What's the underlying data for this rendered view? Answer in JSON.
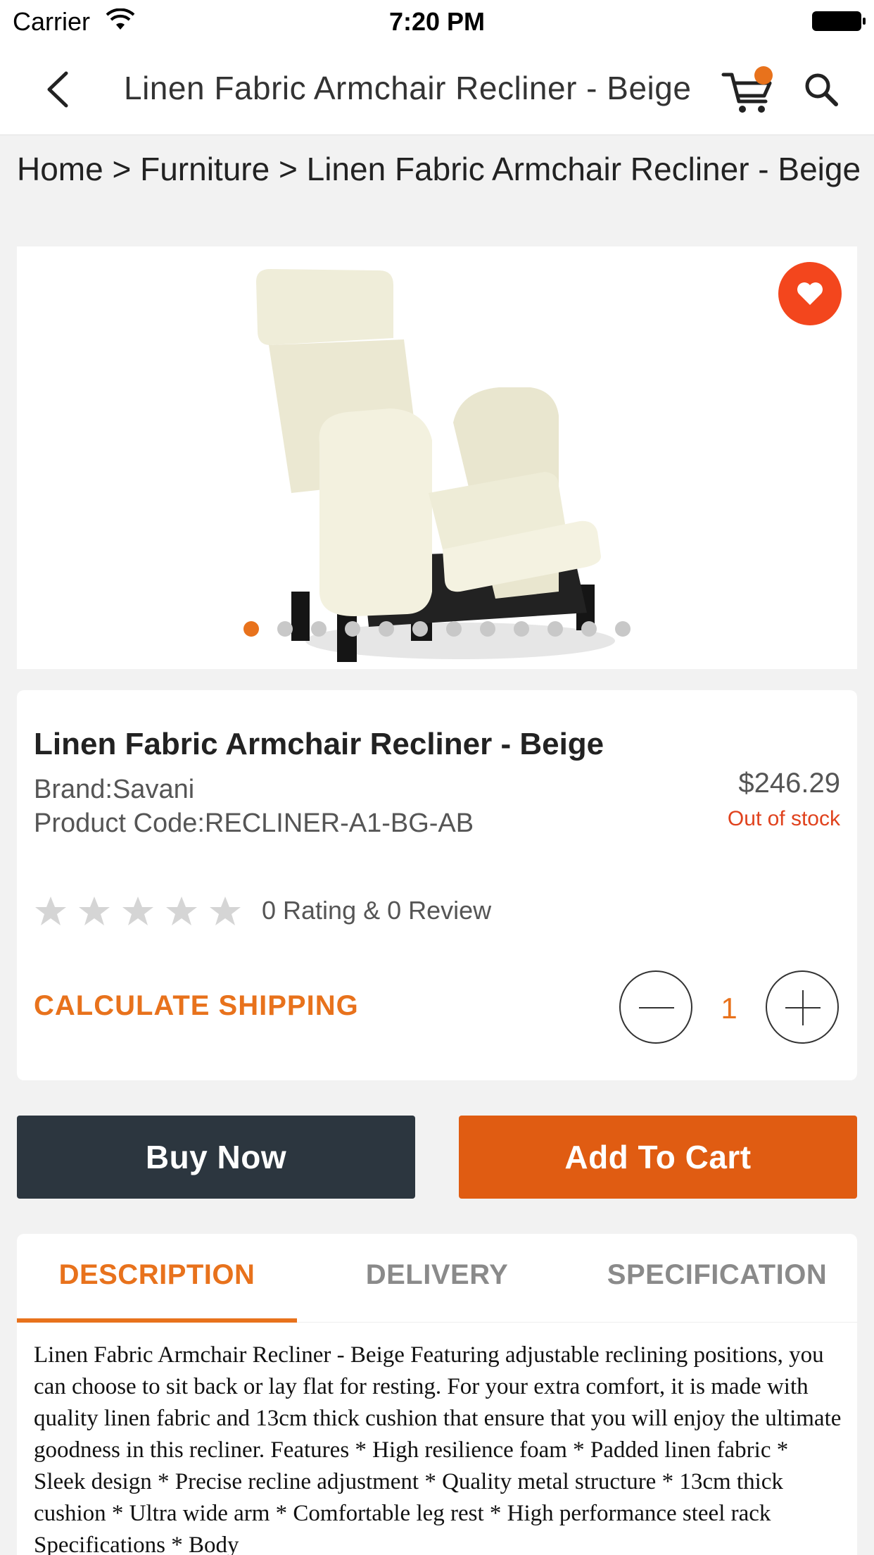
{
  "status_bar": {
    "carrier": "Carrier",
    "time": "7:20 PM"
  },
  "nav": {
    "title": "Linen Fabric Armchair Recliner - Beige",
    "cart_badge_color": "#e8721c"
  },
  "breadcrumb": "Home > Furniture > Linen Fabric Armchair Recliner - Beige",
  "gallery": {
    "dot_count": 12,
    "active_dot": 0
  },
  "product": {
    "title": "Linen Fabric Armchair Recliner - Beige",
    "brand": "Brand:Savani",
    "code": "Product Code:RECLINER-A1-BG-AB",
    "price": "$246.29",
    "stock_status": "Out of stock",
    "rating": 0,
    "rating_text": "0 Rating & 0 Review",
    "calculate_shipping": "CALCULATE SHIPPING",
    "quantity": "1"
  },
  "actions": {
    "buy_now": "Buy Now",
    "add_to_cart": "Add To Cart"
  },
  "tabs": [
    {
      "label": "DESCRIPTION",
      "active": true
    },
    {
      "label": "DELIVERY",
      "active": false
    },
    {
      "label": "SPECIFICATION",
      "active": false
    }
  ],
  "description": "Linen Fabric Armchair Recliner - Beige Featuring adjustable reclining positions, you can choose to sit back or lay flat for resting. For your extra comfort, it is made with quality linen fabric and 13cm thick cushion that ensure that you will enjoy the ultimate goodness in this recliner. Features * High resilience foam * Padded linen fabric * Sleek design * Precise recline adjustment * Quality metal structure * 13cm thick cushion * Ultra wide arm * Comfortable leg rest * High performance steel rack Specifications * Body",
  "colors": {
    "accent": "#e8721c",
    "favorite": "#f3461d",
    "buy_now_bg": "#2c363f",
    "add_to_cart_bg": "#e05c12",
    "out_of_stock": "#e0421d"
  }
}
